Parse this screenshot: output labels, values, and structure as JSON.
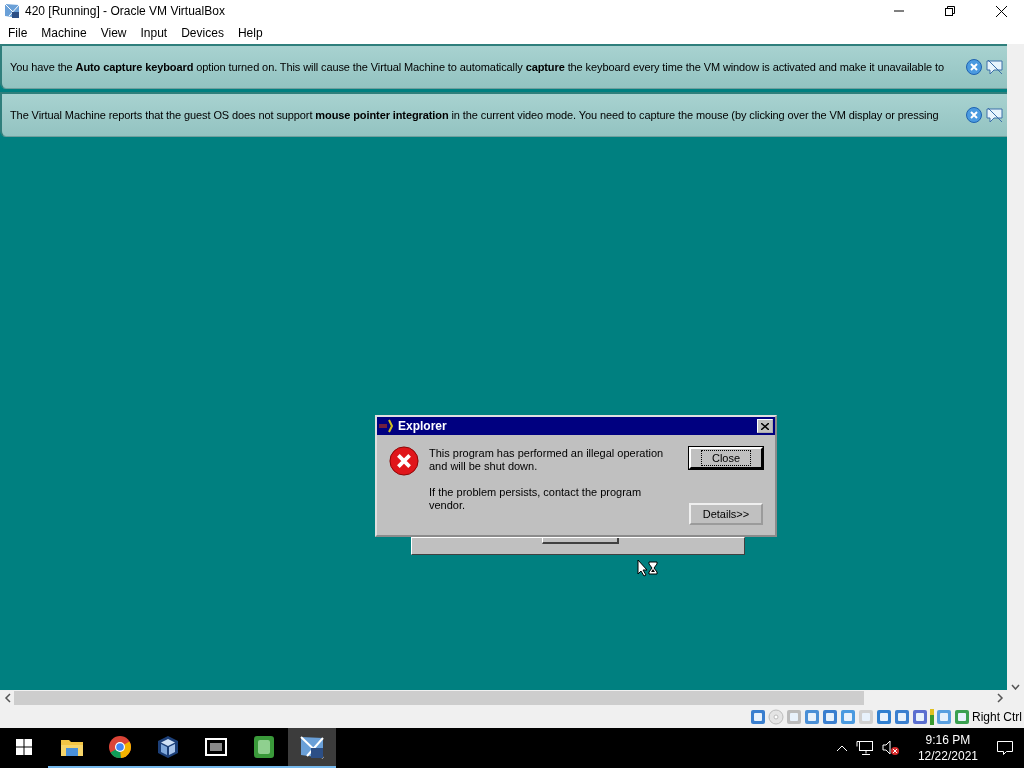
{
  "window": {
    "title": "420 [Running] - Oracle VM VirtualBox"
  },
  "menu": [
    "File",
    "Machine",
    "View",
    "Input",
    "Devices",
    "Help"
  ],
  "notices": [
    {
      "text": "You have the **Auto capture keyboard** option turned on. This will cause the Virtual Machine to automatically **capture** the keyboard every time the VM window is activated and make it unavailable to"
    },
    {
      "text": "The Virtual Machine reports that the guest OS does not support **mouse pointer integration** in the current video mode. You need to capture the mouse (by clicking over the VM display or pressing"
    }
  ],
  "vm_screen": {
    "dialog": {
      "title": "Explorer",
      "messages": [
        "This program has performed an illegal operation and will be shut down.",
        "If the problem persists, contact the program vendor."
      ],
      "buttons": [
        {
          "label": "Close",
          "selected": true
        },
        {
          "label": "Details>>",
          "selected": false
        }
      ]
    }
  },
  "status_bar": {
    "host_key": "Right Ctrl"
  },
  "taskbar": {
    "apps": [
      {
        "kind": "explorer",
        "running": true,
        "active": false
      },
      {
        "kind": "chrome",
        "running": true,
        "active": false
      },
      {
        "kind": "virtualbox",
        "running": true,
        "active": false
      },
      {
        "kind": "archiver",
        "running": true,
        "active": false
      },
      {
        "kind": "hexeditor",
        "running": true,
        "active": false
      },
      {
        "kind": "vm",
        "running": true,
        "active": true
      }
    ],
    "clock": {
      "time": "9:16 PM",
      "date": "12/22/2021"
    }
  }
}
